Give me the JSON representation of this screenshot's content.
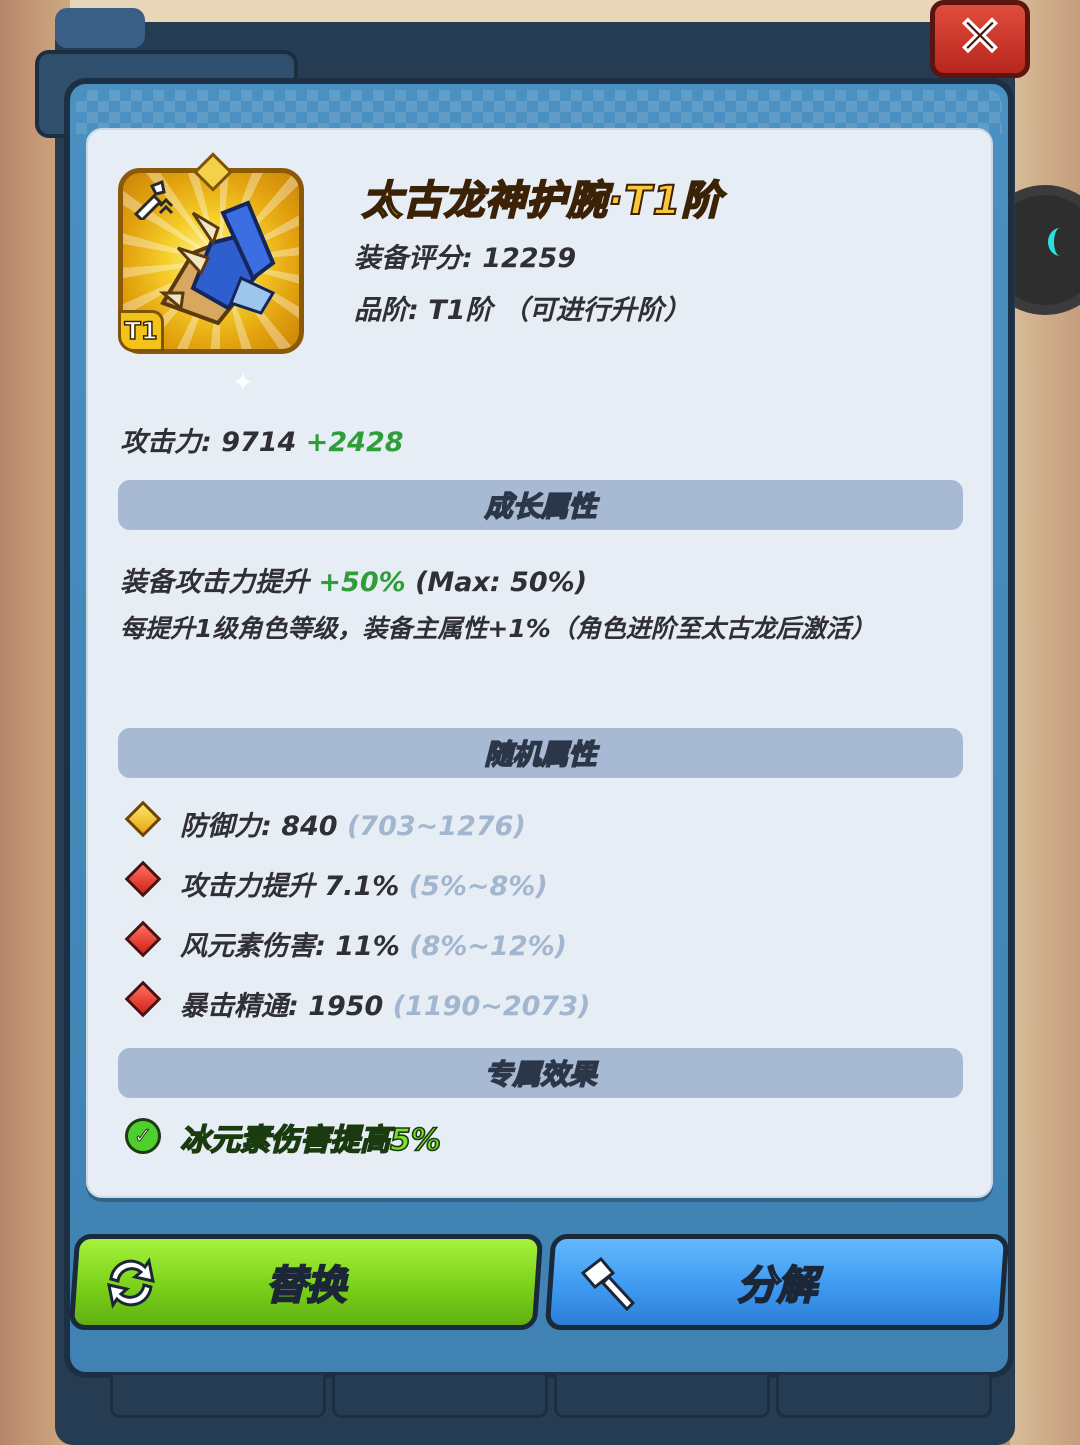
{
  "item": {
    "name": "太古龙神护腕·T1阶",
    "score_label": "装备评分: 12259",
    "tier_label": "品阶: T1阶 （可进行升阶）",
    "tier_badge": "T1",
    "icon": "gauntlet-icon",
    "class_icon": "sword-rank-icon"
  },
  "attack": {
    "label": "攻击力: 9714",
    "bonus": "+2428"
  },
  "growth": {
    "title": "成长属性",
    "line1_prefix": "装备攻击力提升",
    "line1_bonus": "+50%",
    "line1_suffix": "(Max: 50%)",
    "line2": "每提升1级角色等级，装备主属性+1%（角色进阶至太古龙后激活）"
  },
  "random": {
    "title": "随机属性",
    "stats": [
      {
        "label": "防御力: 840",
        "range": "(703~1276)",
        "gem": "gold"
      },
      {
        "label": "攻击力提升 7.1%",
        "range": "(5%~8%)",
        "gem": "red"
      },
      {
        "label": "风元素伤害: 11%",
        "range": "(8%~12%)",
        "gem": "red"
      },
      {
        "label": "暴击精通: 1950",
        "range": "(1190~2073)",
        "gem": "red"
      }
    ]
  },
  "exclusive": {
    "title": "专属效果",
    "effect": "冰元素伤害提高5%"
  },
  "buttons": {
    "replace": "替换",
    "decompose": "分解"
  },
  "colors": {
    "accent_green": "#7cd11a",
    "accent_blue": "#3f9af0",
    "title_gold": "#fbc63a",
    "bonus_green": "#2f9e3a"
  }
}
